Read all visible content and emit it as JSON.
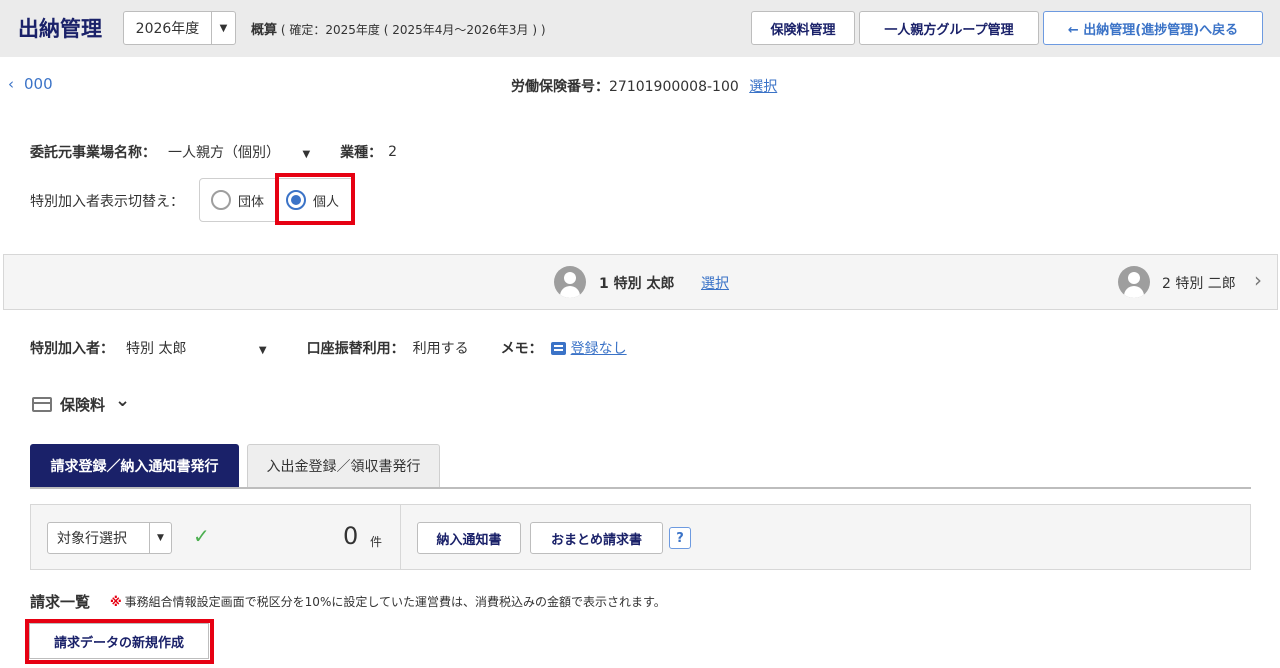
{
  "header": {
    "app_title": "出納管理",
    "fiscal_year": "2026年度",
    "summary_label": "概算",
    "summary_detail": "( 確定：2025年度 ( 2025年4月～2026年3月 ) )",
    "buttons": {
      "premium": "保険料管理",
      "single_parent_group": "一人親方グループ管理",
      "back": "← 出納管理(進捗管理)へ戻る"
    }
  },
  "subnav": {
    "back_chevron": "‹",
    "back_label": "000",
    "insurance_no_label": "労働保険番号：",
    "insurance_no_value": "27101900008-100",
    "select_link": "選択"
  },
  "business": {
    "entrust_label": "委託元事業場名称：",
    "entrust_value": "一人親方（個別）",
    "industry_label": "業種：",
    "industry_value": "2"
  },
  "display_toggle": {
    "label": "特別加入者表示切替え：",
    "options": [
      {
        "label": "団体",
        "selected": false
      },
      {
        "label": "個人",
        "selected": true
      }
    ]
  },
  "person_bar": {
    "current": "1 特別 太郎",
    "select_link": "選択",
    "next": "2 特別 二郎",
    "next_chevron": "›"
  },
  "member_info": {
    "member_label": "特別加入者：",
    "member_value": "特別 太郎",
    "transfer_label": "口座振替利用：",
    "transfer_value": "利用する",
    "memo_label": "メモ：",
    "memo_value": "登録なし"
  },
  "section": {
    "title": "保険料",
    "toggle": "⌄"
  },
  "tabs": [
    {
      "label": "請求登録／納入通知書発行",
      "active": true
    },
    {
      "label": "入出金登録／領収書発行",
      "active": false
    }
  ],
  "action_panel": {
    "select_value": "対象行選択",
    "check_mark": "✓",
    "count_value": "0",
    "count_unit": "件",
    "notice_button": "納入通知書",
    "bulk_invoice_button": "おまとめ請求書",
    "help": "?"
  },
  "invoice_list": {
    "title": "請求一覧",
    "note_mark": "※",
    "note": "事務組合情報設定画面で税区分を10%に設定していた運営費は、消費税込みの金額で表示されます。",
    "new_button": "請求データの新規作成"
  },
  "colors": {
    "brand_navy": "#1a2169",
    "link_blue": "#3b73c7",
    "highlight_red": "#e60012",
    "check_green": "#4caf50"
  }
}
